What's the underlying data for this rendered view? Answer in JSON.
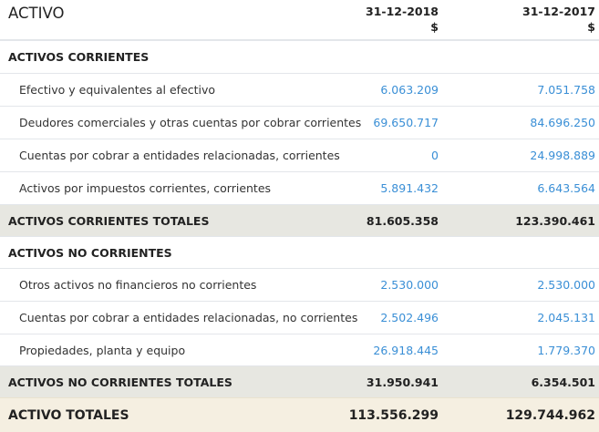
{
  "header": {
    "title": "ACTIVO",
    "columns": [
      {
        "date": "31-12-2018",
        "currency": "$"
      },
      {
        "date": "31-12-2017",
        "currency": "$"
      }
    ]
  },
  "sections": {
    "corrientes": {
      "title": "ACTIVOS CORRIENTES",
      "rows": [
        {
          "label": "Efectivo y equivalentes al efectivo",
          "v2018": "6.063.209",
          "v2017": "7.051.758"
        },
        {
          "label": "Deudores comerciales y otras cuentas por cobrar corrientes",
          "v2018": "69.650.717",
          "v2017": "84.696.250"
        },
        {
          "label": "Cuentas por cobrar a entidades relacionadas, corrientes",
          "v2018": "0",
          "v2017": "24.998.889"
        },
        {
          "label": "Activos por impuestos corrientes, corrientes",
          "v2018": "5.891.432",
          "v2017": "6.643.564"
        }
      ],
      "total": {
        "label": "ACTIVOS CORRIENTES TOTALES",
        "v2018": "81.605.358",
        "v2017": "123.390.461"
      }
    },
    "no_corrientes": {
      "title": "ACTIVOS NO CORRIENTES",
      "rows": [
        {
          "label": "Otros activos no financieros no corrientes",
          "v2018": "2.530.000",
          "v2017": "2.530.000"
        },
        {
          "label": "Cuentas por cobrar a entidades relacionadas, no corrientes",
          "v2018": "2.502.496",
          "v2017": "2.045.131"
        },
        {
          "label": "Propiedades, planta y equipo",
          "v2018": "26.918.445",
          "v2017": "1.779.370"
        }
      ],
      "total": {
        "label": "ACTIVOS NO CORRIENTES TOTALES",
        "v2018": "31.950.941",
        "v2017": "6.354.501"
      }
    }
  },
  "grand_total": {
    "label": "ACTIVO TOTALES",
    "v2018": "113.556.299",
    "v2017": "129.744.962"
  },
  "colors": {
    "link": "#3a8fd6",
    "total_bg": "#e7e7e1",
    "grand_bg": "#f5efe1"
  }
}
